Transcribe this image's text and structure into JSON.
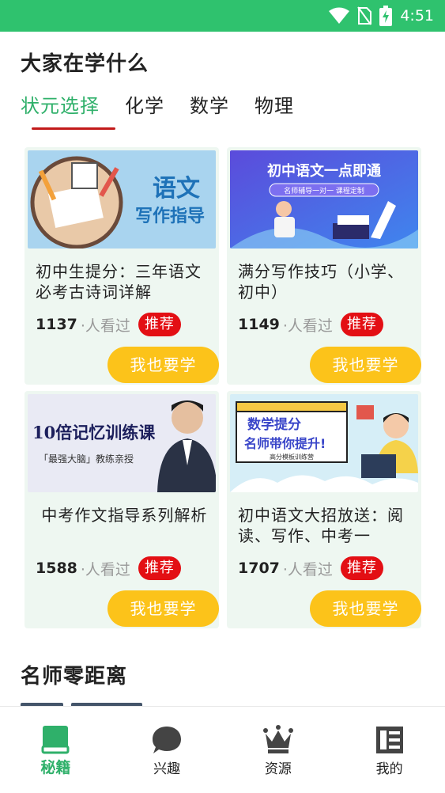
{
  "status_bar": {
    "time": "4:51",
    "bg_color": "#2fc26e",
    "icons": [
      "wifi-icon",
      "no-sim-icon",
      "battery-charging-icon"
    ]
  },
  "section1": {
    "title": "大家在学什么"
  },
  "tabs": [
    {
      "label": "状元选择",
      "active": true
    },
    {
      "label": "化学",
      "active": false
    },
    {
      "label": "数学",
      "active": false
    },
    {
      "label": "物理",
      "active": false
    }
  ],
  "cards": [
    {
      "title": "初中生提分：三年语文必考古诗词详解",
      "views": "1137",
      "views_label": "·人看过",
      "badge": "推荐",
      "button": "我也要学",
      "thumb": {
        "line1": "语文",
        "line2": "写作指导"
      }
    },
    {
      "title": "满分写作技巧（小学、初中）",
      "views": "1149",
      "views_label": "·人看过",
      "badge": "推荐",
      "button": "我也要学",
      "thumb": {
        "line1": "初中语文一点即通",
        "line2": "名师辅导一对一 课程定制"
      }
    },
    {
      "title": " 中考作文指导系列解析",
      "views": "1588",
      "views_label": "·人看过",
      "badge": "推荐",
      "button": "我也要学",
      "thumb": {
        "line1": "10倍记忆训练课",
        "line2": "「最强大脑」教练亲授"
      }
    },
    {
      "title": "初中语文大招放送：阅读、写作、中考一",
      "views": "1707",
      "views_label": "·人看过",
      "badge": "推荐",
      "button": "我也要学",
      "thumb": {
        "line1": "数学提分",
        "line2": "名师带你提升!",
        "line3": "高分模板训练营"
      }
    }
  ],
  "section2": {
    "title": "名师零距离"
  },
  "bottom_nav": [
    {
      "label": "秘籍",
      "icon": "book-icon",
      "active": true
    },
    {
      "label": "兴趣",
      "icon": "chat-bubble-icon",
      "active": false
    },
    {
      "label": "资源",
      "icon": "crown-icon",
      "active": false
    },
    {
      "label": "我的",
      "icon": "profile-list-icon",
      "active": false
    }
  ],
  "colors": {
    "accent_green": "#2fb06a",
    "badge_red": "#e30f14",
    "button_yellow": "#fcc31a",
    "card_bg": "#eef7f1"
  }
}
